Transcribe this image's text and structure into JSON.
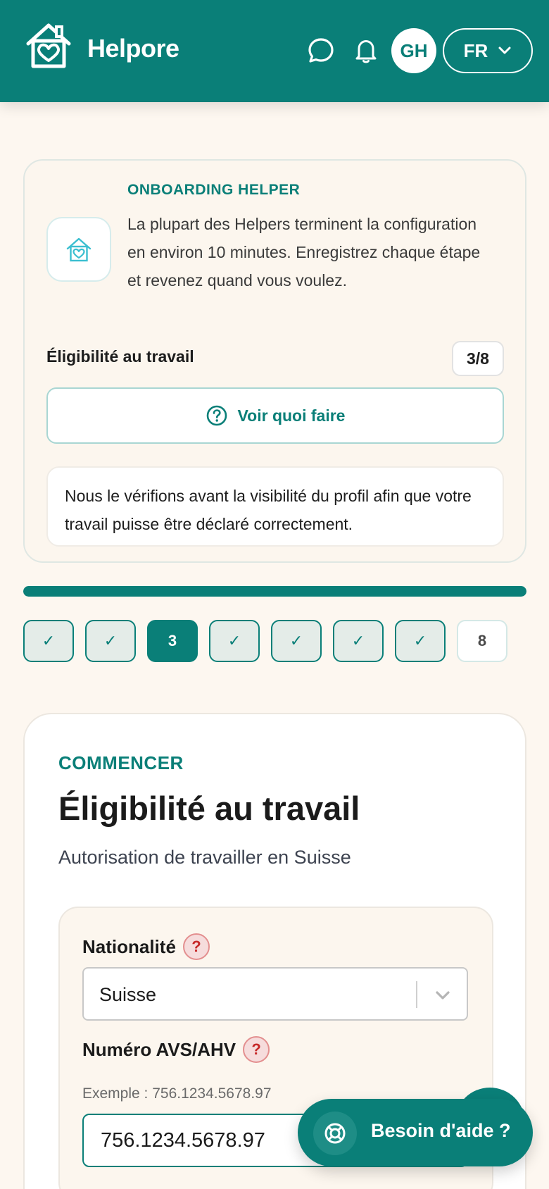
{
  "header": {
    "brand": "Helpore",
    "avatar_initials": "GH",
    "language": "FR",
    "icons": [
      "house-heart-logo-icon",
      "chat-icon",
      "bell-icon",
      "chevron-down-icon"
    ],
    "color": "#0a7f78"
  },
  "onboarding": {
    "kicker": "ONBOARDING HELPER",
    "description": "La plupart des Helpers terminent la configuration en environ 10 minutes. Enregistrez chaque étape et revenez quand vous voulez.",
    "current_step_label": "Éligibilité au travail",
    "step_count": "3/8",
    "help_button": "Voir quoi faire",
    "note": "Nous le vérifions avant la visibilité du profil afin que votre travail puisse être déclaré correctement."
  },
  "progress": {
    "fraction": 1.0,
    "steps": [
      {
        "label": "✓",
        "state": "done"
      },
      {
        "label": "✓",
        "state": "done"
      },
      {
        "label": "3",
        "state": "current"
      },
      {
        "label": "✓",
        "state": "done"
      },
      {
        "label": "✓",
        "state": "done"
      },
      {
        "label": "✓",
        "state": "done"
      },
      {
        "label": "✓",
        "state": "done"
      },
      {
        "label": "8",
        "state": "todo"
      }
    ]
  },
  "main": {
    "kicker": "COMMENCER",
    "title": "Éligibilité au travail",
    "subtitle": "Autorisation de travailler en Suisse",
    "nationality": {
      "label": "Nationalité",
      "help": "?",
      "value": "Suisse"
    },
    "avs": {
      "label": "Numéro AVS/AHV",
      "help": "?",
      "hint": "Exemple : 756.1234.5678.97",
      "value": "756.1234.5678.97"
    }
  },
  "help_fab": {
    "label": "Besoin d'aide ?"
  }
}
